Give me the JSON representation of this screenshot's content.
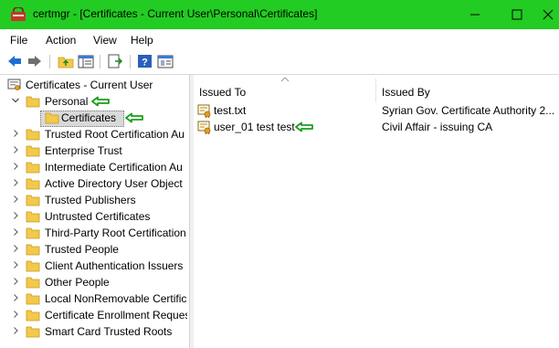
{
  "window": {
    "title": "certmgr - [Certificates - Current User\\Personal\\Certificates]",
    "minimize_glyph": "—",
    "maximize_glyph": "☐",
    "close_glyph": "✕"
  },
  "menu": [
    "File",
    "Action",
    "View",
    "Help"
  ],
  "toolbar": {
    "buttons": [
      "back-icon",
      "forward-icon",
      "up-folder-icon",
      "show-hide-tree-icon",
      "export-list-icon",
      "help-icon",
      "properties-icon"
    ]
  },
  "tree": {
    "root": "Certificates - Current User",
    "items": [
      {
        "label": "Personal",
        "expanded": true
      },
      {
        "label": "Certificates",
        "selected": true
      },
      {
        "label": "Trusted Root Certification Au"
      },
      {
        "label": "Enterprise Trust"
      },
      {
        "label": "Intermediate Certification Au"
      },
      {
        "label": "Active Directory User Object"
      },
      {
        "label": "Trusted Publishers"
      },
      {
        "label": "Untrusted Certificates"
      },
      {
        "label": "Third-Party Root Certification"
      },
      {
        "label": "Trusted People"
      },
      {
        "label": "Client Authentication Issuers"
      },
      {
        "label": "Other People"
      },
      {
        "label": "Local NonRemovable Certific"
      },
      {
        "label": "Certificate Enrollment Reques"
      },
      {
        "label": "Smart Card Trusted Roots"
      }
    ]
  },
  "list": {
    "columns": [
      "Issued To",
      "Issued By"
    ],
    "rows": [
      {
        "issued_to": "test.txt",
        "issued_by": "Syrian Gov. Certificate Authority 2..."
      },
      {
        "issued_to": "user_01 test test",
        "issued_by": "Civil Affair - issuing CA"
      }
    ]
  },
  "colors": {
    "titlebar": "#22cc22",
    "highlight_arrow": "#1a9e1a",
    "folder": "#f2c94c"
  }
}
